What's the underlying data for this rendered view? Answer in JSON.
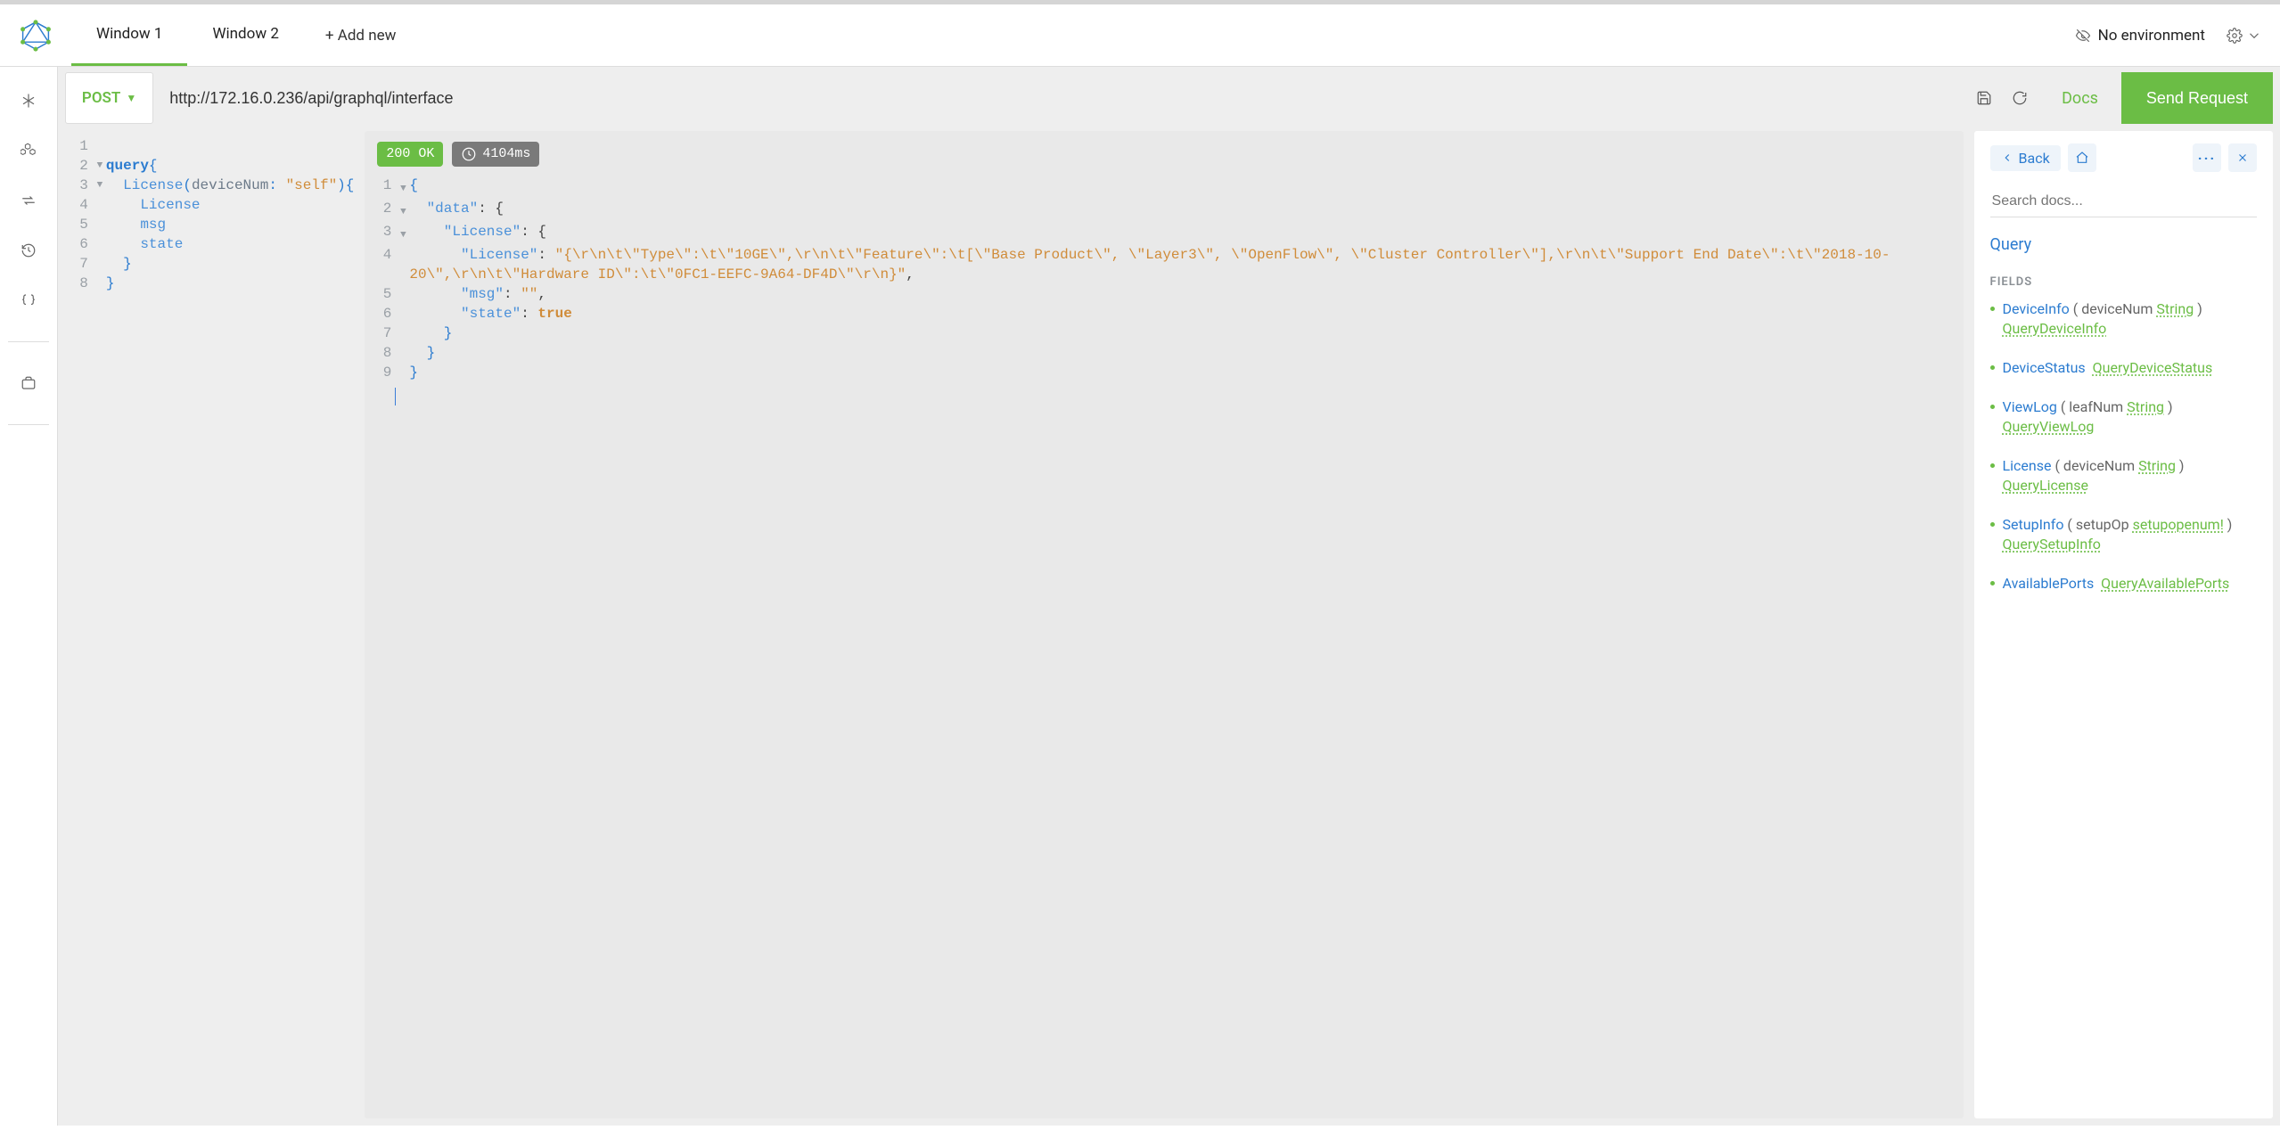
{
  "header": {
    "tabs": [
      "Window 1",
      "Window 2"
    ],
    "add_tab_label": "+ Add new",
    "environment_label": "No environment"
  },
  "urlbar": {
    "method": "POST",
    "url": "http://172.16.0.236/api/graphql/interface",
    "docs_label": "Docs",
    "send_label": "Send Request"
  },
  "result": {
    "status_badge": "200 OK",
    "time_badge": "4104ms"
  },
  "query_lines": {
    "l2_kw": "query",
    "l2_suffix": "{",
    "l3_field": "License",
    "l3_open_paren": "(",
    "l3_arg": "deviceNum",
    "l3_colon": ": ",
    "l3_str": "\"self\"",
    "l3_close": "){",
    "l4": "License",
    "l5": "msg",
    "l6": "state",
    "l7": "}",
    "l8": "}"
  },
  "response_lines": {
    "l1": "{",
    "l2_key": "\"data\"",
    "l2_rest": ": {",
    "l3_key": "\"License\"",
    "l3_rest": ": {",
    "l4_key": "\"License\"",
    "l4_colon": ": ",
    "l4_val": "\"{\\r\\n\\t\\\"Type\\\":\\t\\\"10GE\\\",\\r\\n\\t\\\"Feature\\\":\\t[\\\"Base Product\\\", \\\"Layer3\\\", \\\"OpenFlow\\\", \\\"Cluster Controller\\\"],\\r\\n\\t\\\"Support End Date\\\":\\t\\\"2018-10-20\\\",\\r\\n\\t\\\"Hardware ID\\\":\\t\\\"0FC1-EEFC-9A64-DF4D\\\"\\r\\n}\"",
    "l4_comma": ",",
    "l5_key": "\"msg\"",
    "l5_rest": ": ",
    "l5_val": "\"\"",
    "l5_comma": ",",
    "l6_key": "\"state\"",
    "l6_rest": ": ",
    "l6_val": "true",
    "l7": "}",
    "l8": "}",
    "l9": "}"
  },
  "docs": {
    "back_label": "Back",
    "search_placeholder": "Search docs...",
    "root_type": "Query",
    "fields_label": "FIELDS",
    "fields": [
      {
        "name": "DeviceInfo",
        "arg": "deviceNum",
        "arg_type": "String",
        "ret": "QueryDeviceInfo"
      },
      {
        "name": "DeviceStatus",
        "arg": null,
        "arg_type": null,
        "ret": "QueryDeviceStatus"
      },
      {
        "name": "ViewLog",
        "arg": "leafNum",
        "arg_type": "String",
        "ret": "QueryViewLog"
      },
      {
        "name": "License",
        "arg": "deviceNum",
        "arg_type": "String",
        "ret": "QueryLicense"
      },
      {
        "name": "SetupInfo",
        "arg": "setupOp",
        "arg_type": "setupopenum!",
        "ret": "QuerySetupInfo"
      },
      {
        "name": "AvailablePorts",
        "arg": null,
        "arg_type": null,
        "ret": "QueryAvailablePorts"
      }
    ]
  }
}
